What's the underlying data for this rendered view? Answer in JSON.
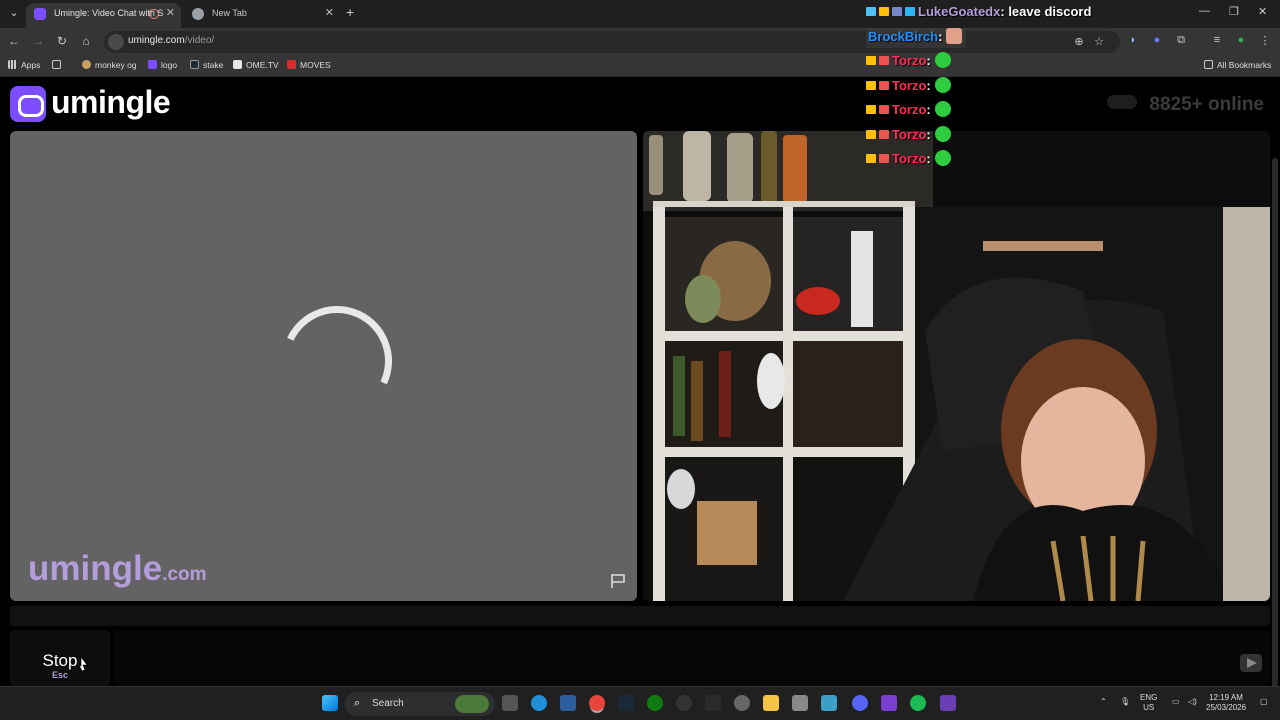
{
  "browser": {
    "tabs": [
      {
        "title": "Umingle: Video Chat with S",
        "active": true
      },
      {
        "title": "New Tab",
        "active": false
      }
    ],
    "address": {
      "host": "umingle.com",
      "path": "/video/"
    },
    "bookmarks": [
      {
        "label": "Apps",
        "icon": "grid-icon"
      },
      {
        "label": "monkey og",
        "icon": "monkey-icon"
      },
      {
        "label": "logo",
        "icon": "s-icon"
      },
      {
        "label": "stake",
        "icon": "s-icon"
      },
      {
        "label": "OME.TV",
        "icon": "ometv-icon"
      },
      {
        "label": "MOVES",
        "icon": "123-icon"
      }
    ],
    "all_bookmarks": "All Bookmarks"
  },
  "page": {
    "logo_text": "umingle",
    "online_count": "8825",
    "online_suffix": "+ online",
    "watermark_main": "umingle",
    "watermark_domain": ".com",
    "stop_label": "Stop",
    "stop_key": "Esc"
  },
  "overlay_chat": [
    {
      "user": "LukeGoatedx",
      "sep": ":",
      "message": " leave discord",
      "color": "#b39ddb"
    },
    {
      "user": "BrockBirch",
      "sep": ":",
      "message": "",
      "color": "#1e90ff"
    },
    {
      "user": "Torzo",
      "sep": ":",
      "message": "",
      "color": "#ff2d55"
    },
    {
      "user": "Torzo",
      "sep": ":",
      "message": "",
      "color": "#ff2d55"
    },
    {
      "user": "Torzo",
      "sep": ":",
      "message": "",
      "color": "#ff2d55"
    },
    {
      "user": "Torzo",
      "sep": ":",
      "message": "",
      "color": "#ff2d55"
    },
    {
      "user": "Torzo",
      "sep": ":",
      "message": "",
      "color": "#ff2d55"
    }
  ],
  "taskbar": {
    "search_label": "Search",
    "lang_top": "ENG",
    "lang_bottom": "US",
    "time": "12:19 AM",
    "date": "25/03/2026"
  },
  "colors": {
    "brand": "#7c4dff",
    "watermark": "#b39ddb",
    "video_placeholder": "#636363"
  }
}
